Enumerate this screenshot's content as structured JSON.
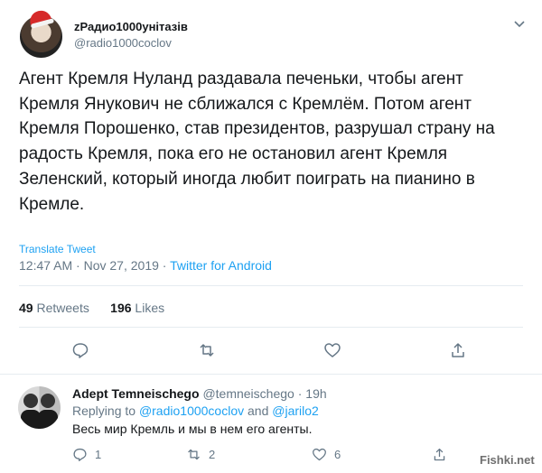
{
  "tweet": {
    "display_name": "zРадио1000унітазів",
    "handle": "@radio1000coclov",
    "text": "Агент Кремля Нуланд раздавала печеньки, чтобы агент Кремля Янукович не сближался с Кремлём. Потом агент Кремля Порошенко, став президентов, разрушал страну на радость Кремля, пока его не остановил агент Кремля Зеленский, который иногда любит поиграть на пианино в Кремле.",
    "translate_label": "Translate Tweet",
    "time": "12:47 AM",
    "sep1": "·",
    "date": "Nov 27, 2019",
    "sep2": "·",
    "source": "Twitter for Android",
    "retweets_count": "49",
    "retweets_label": "Retweets",
    "likes_count": "196",
    "likes_label": "Likes"
  },
  "actions": {
    "icons": [
      "comment-icon",
      "retweet-icon",
      "like-icon",
      "share-icon"
    ]
  },
  "reply": {
    "display_name": "Adept Temneischego",
    "handle": "@temneischego",
    "sep": "·",
    "time": "19h",
    "replying_label": "Replying to",
    "mention1": "@radio1000coclov",
    "and": "and",
    "mention2": "@jarilo2",
    "text": "Весь мир Кремль и мы в нем его агенты.",
    "comment_count": "1",
    "retweet_count": "2",
    "like_count": "6"
  },
  "watermark": "Fishki.net",
  "colors": {
    "link": "#1da1f2",
    "muted": "#657786",
    "text": "#14171a",
    "divider": "#e6ecf0"
  }
}
